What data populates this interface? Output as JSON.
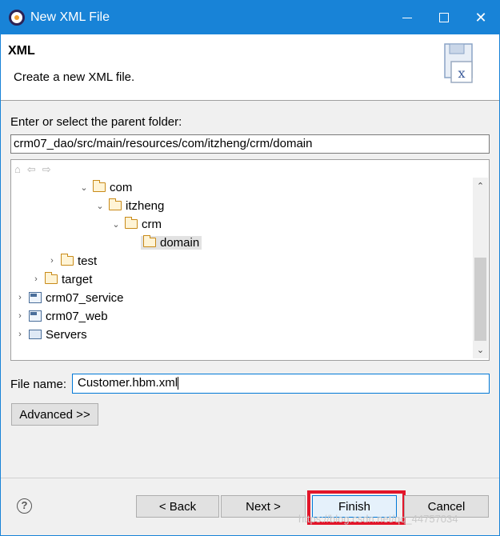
{
  "window": {
    "title": "New XML File",
    "minimize_icon": "minimize-icon",
    "maximize_icon": "maximize-icon",
    "close_icon": "close-icon"
  },
  "header": {
    "title": "XML",
    "description": "Create a new XML file."
  },
  "parent_folder": {
    "label": "Enter or select the parent folder:",
    "value": "crm07_dao/src/main/resources/com/itzheng/crm/domain"
  },
  "tree": {
    "toolbar_icons": [
      "home-icon",
      "back-arrow-icon",
      "forward-arrow-icon"
    ],
    "items": [
      {
        "label": "com",
        "expanded": true,
        "kind": "folder"
      },
      {
        "label": "itzheng",
        "expanded": true,
        "kind": "folder"
      },
      {
        "label": "crm",
        "expanded": true,
        "kind": "folder"
      },
      {
        "label": "domain",
        "selected": true,
        "kind": "folder"
      },
      {
        "label": "test",
        "expanded": false,
        "kind": "folder"
      },
      {
        "label": "target",
        "expanded": false,
        "kind": "folder"
      },
      {
        "label": "crm07_service",
        "expanded": false,
        "kind": "project"
      },
      {
        "label": "crm07_web",
        "expanded": false,
        "kind": "project"
      },
      {
        "label": "Servers",
        "expanded": false,
        "kind": "servers"
      }
    ]
  },
  "file_name": {
    "label": "File name:",
    "value": "Customer.hbm.xml"
  },
  "buttons": {
    "advanced": "Advanced >>",
    "back": "< Back",
    "next": "Next >",
    "finish": "Finish",
    "cancel": "Cancel"
  },
  "colors": {
    "titlebar": "#1883d7",
    "highlight": "#e2162a"
  },
  "watermark": "https://blog.csdn.net/qq_44757034"
}
